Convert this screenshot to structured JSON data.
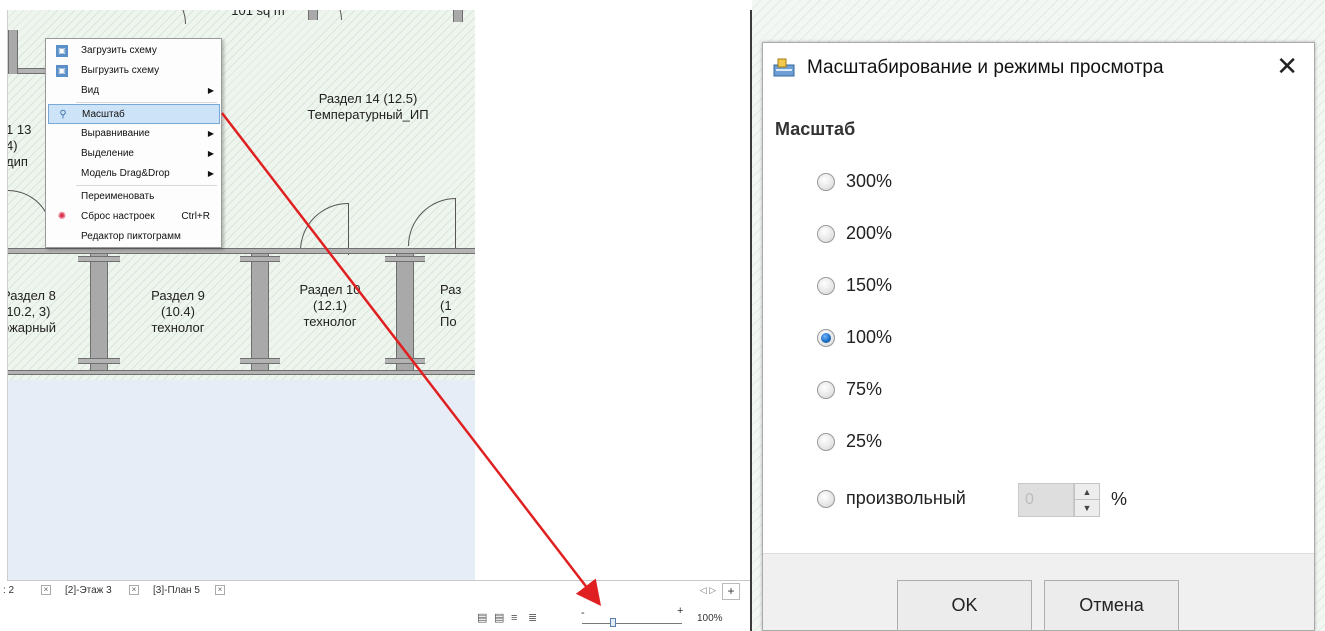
{
  "plan": {
    "top_label": "101 sq m",
    "room_left_top": "1 13\n4)\nдип",
    "room_14": "Раздел 14 (12.5)\nТемпературный_ИП",
    "room_8": "Раздел 8\n(10.2, 3)\nожарный",
    "room_9": "Раздел 9\n(10.4)\nтехнолог",
    "room_10": "Раздел 10\n(12.1)\nтехнолог",
    "room_right": "Раз\n(1\nПо"
  },
  "context_menu": {
    "items": [
      {
        "label": "Загрузить схему",
        "icon": "upload-scheme-icon"
      },
      {
        "label": "Выгрузить схему",
        "icon": "download-scheme-icon"
      },
      {
        "label": "Вид",
        "submenu": true
      },
      {
        "label": "Масштаб",
        "icon": "magnifier-icon",
        "selected": true
      },
      {
        "label": "Выравнивание",
        "submenu": true
      },
      {
        "label": "Выделение",
        "submenu": true
      },
      {
        "label": "Модель Drag&Drop",
        "submenu": true
      },
      {
        "label": "Переименовать"
      },
      {
        "label": "Сброс настроек",
        "shortcut": "Ctrl+R",
        "icon": "reset-icon"
      },
      {
        "label": "Редактор пиктограмм"
      }
    ]
  },
  "tabs": {
    "items": [
      {
        "label": ": 2"
      },
      {
        "label": "[2]-Этаж 3"
      },
      {
        "label": "[3]-План 5"
      }
    ],
    "close_glyph": "×",
    "scroll_glyph": "◁ ▷",
    "add_glyph": "+"
  },
  "status": {
    "zoom_minus": "-",
    "zoom_plus": "+",
    "zoom_value": "100%",
    "zoom_level_percent": 100
  },
  "dialog": {
    "title": "Масштабирование и режимы просмотра",
    "close_glyph": "✕",
    "section_label": "Масштаб",
    "options": [
      {
        "label": "300%",
        "checked": false
      },
      {
        "label": "200%",
        "checked": false
      },
      {
        "label": "150%",
        "checked": false
      },
      {
        "label": "100%",
        "checked": true
      },
      {
        "label": "75%",
        "checked": false
      },
      {
        "label": "25%",
        "checked": false
      },
      {
        "label": "произвольный",
        "checked": false
      }
    ],
    "custom_value": "0",
    "custom_unit": "%",
    "spin_up": "▲",
    "spin_down": "▼",
    "ok_label": "OK",
    "cancel_label": "Отмена"
  },
  "colors": {
    "arrow": "#e02020",
    "menu_selected": "#cde3f7",
    "radio_checked": "#1d6fc4"
  }
}
